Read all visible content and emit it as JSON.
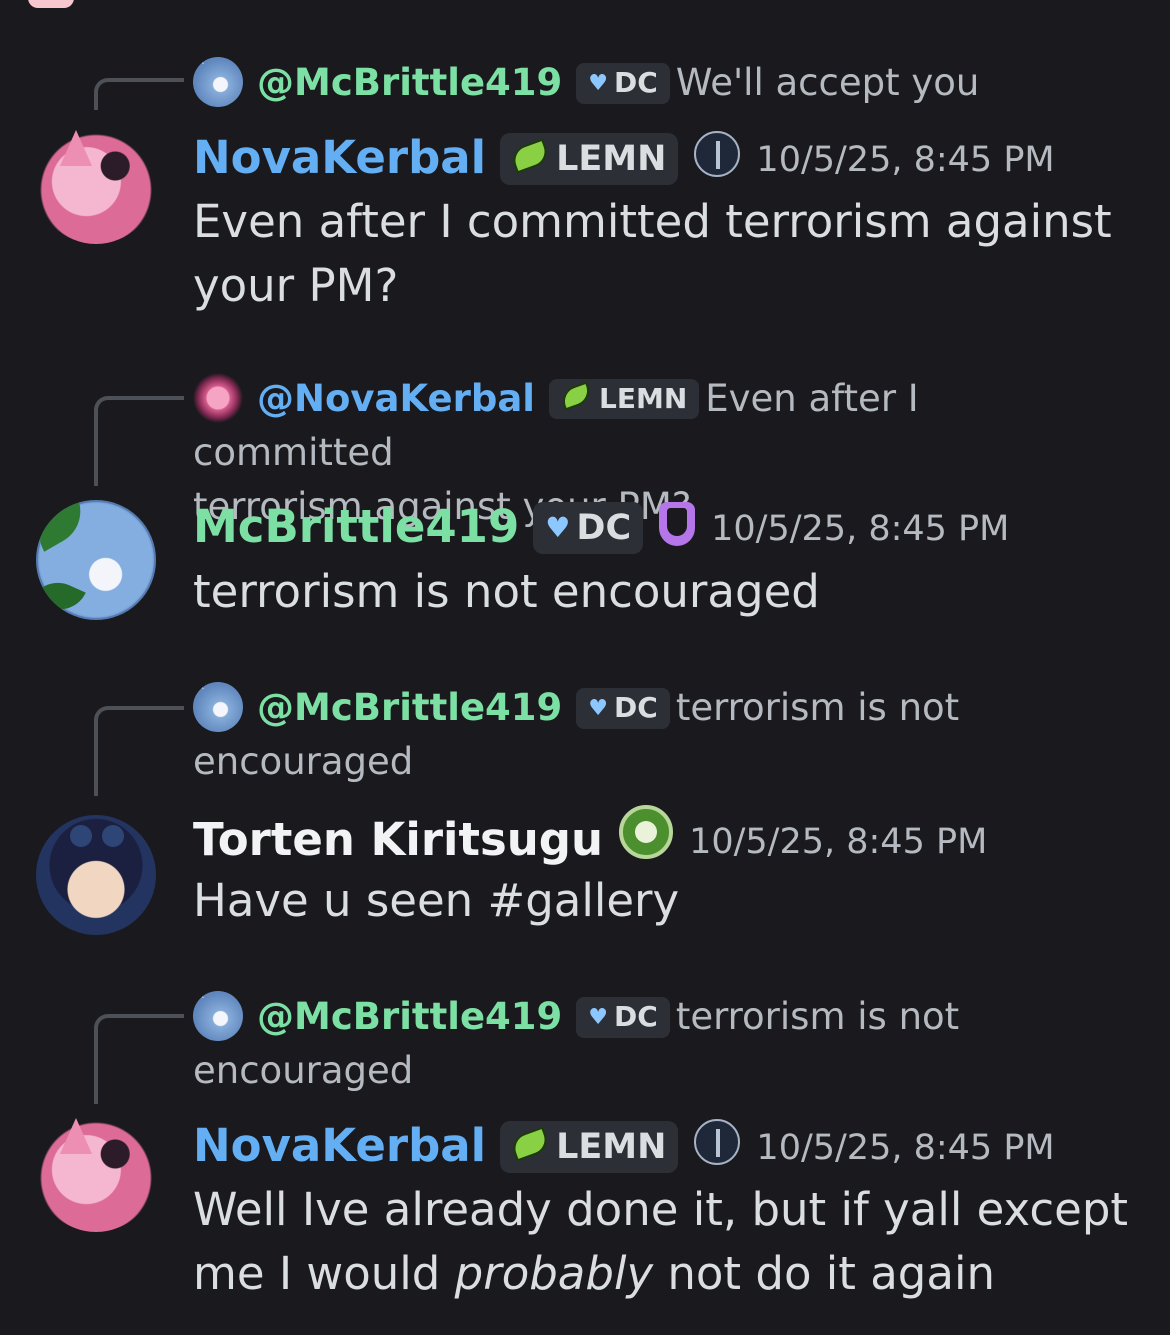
{
  "messages": [
    {
      "reply": {
        "mention": "@McBrittle419",
        "tag": "DC",
        "preview": "We'll accept you"
      },
      "author": "NovaKerbal",
      "tag": "LEMN",
      "timestamp": "10/5/25, 8:45 PM",
      "text": "Even after I committed terrorism against your PM?"
    },
    {
      "reply": {
        "mention": "@NovaKerbal",
        "tag": "LEMN",
        "preview_a": "Even after I committed",
        "preview_b": "terrorism against your PM?"
      },
      "author": "McBrittle419",
      "tag": "DC",
      "timestamp": "10/5/25, 8:45 PM",
      "text": "terrorism is not encouraged"
    },
    {
      "reply": {
        "mention": "@McBrittle419",
        "tag": "DC",
        "preview_a": "terrorism is not",
        "preview_b": "encouraged"
      },
      "author": "Torten Kiritsugu",
      "timestamp": "10/5/25, 8:45 PM",
      "text": "Have u seen #gallery"
    },
    {
      "reply": {
        "mention": "@McBrittle419",
        "tag": "DC",
        "preview_a": "terrorism is not",
        "preview_b": "encouraged"
      },
      "author": "NovaKerbal",
      "tag": "LEMN",
      "timestamp": "10/5/25, 8:45 PM",
      "text_before": "Well Ive already done it, but if yall except me I would ",
      "text_em": "probably",
      "text_after": " not do it again"
    }
  ],
  "avatar_tag": "ck"
}
